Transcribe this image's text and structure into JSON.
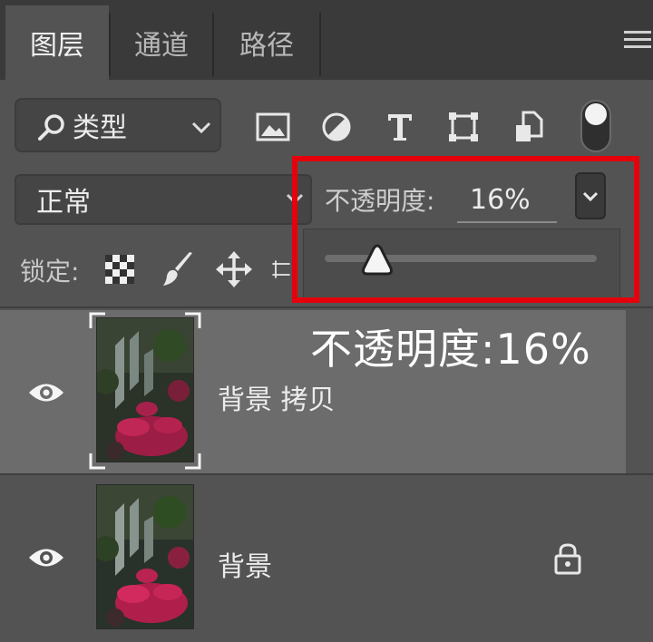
{
  "tabs": [
    {
      "label": "图层",
      "active": true
    },
    {
      "label": "通道",
      "active": false
    },
    {
      "label": "路径",
      "active": false
    }
  ],
  "filter": {
    "kind_label": "类型",
    "icons": [
      "image-filter-icon",
      "adjustment-filter-icon",
      "type-filter-icon",
      "shape-filter-icon",
      "smart-object-filter-icon"
    ]
  },
  "blend": {
    "mode": "正常",
    "opacity_label": "不透明度:",
    "opacity_value": "16%",
    "opacity_percent": 16
  },
  "lock": {
    "label": "锁定:"
  },
  "layers": [
    {
      "name": "背景 拷贝",
      "selected": true,
      "visible": true
    },
    {
      "name": "背景",
      "selected": false,
      "visible": true,
      "locked": true
    }
  ],
  "annotation": {
    "caption": "不透明度:16%",
    "highlight_color": "#e5000b"
  },
  "colors": {
    "panel_bg": "#535353",
    "tab_bar_bg": "#3a3a3a",
    "selected_row": "#6c6c6c"
  }
}
